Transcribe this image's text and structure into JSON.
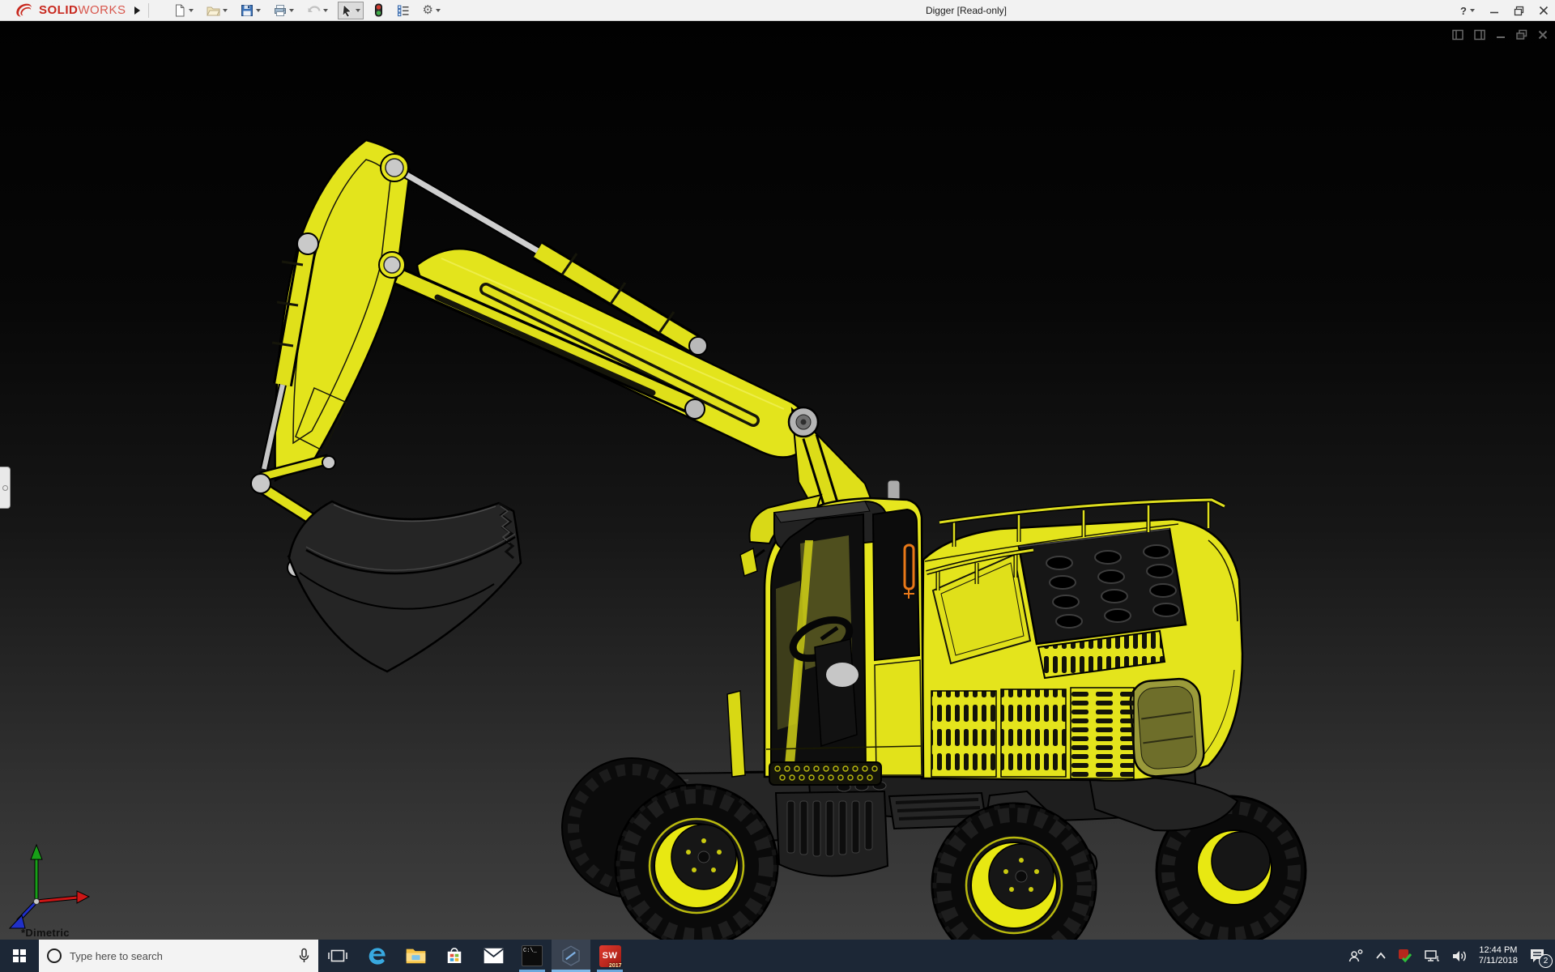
{
  "window": {
    "brand_bold": "SOLID",
    "brand_light": "WORKS",
    "title": "Digger [Read-only]",
    "help_label": "?"
  },
  "toolbar": {
    "icons": [
      "new-document",
      "open",
      "save",
      "print",
      "undo",
      "select-cursor",
      "rebuild-stoplight",
      "file-properties",
      "options-gear"
    ]
  },
  "viewport": {
    "view_label": "*Dimetric",
    "controls": [
      "pane-left-icon",
      "pane-right-icon",
      "minimize-icon",
      "restore-icon",
      "close-icon"
    ]
  },
  "taskbar": {
    "search_placeholder": "Type here to search",
    "cmd_label": "C:\\_",
    "sw_label": "SW",
    "sw_year": "2017",
    "apps": [
      "task-view",
      "edge",
      "file-explorer",
      "store",
      "mail",
      "command-prompt",
      "hexagon-app",
      "solidworks-2017"
    ],
    "tray": {
      "time": "12:44 PM",
      "date": "7/11/2018",
      "notification_count": "2"
    }
  },
  "colors": {
    "excavator_yellow": "#e4e41c",
    "titlebar_bg": "#f2f2f2",
    "taskbar_bg": "#1c2736",
    "taskbar_underline": "#6aa8dc",
    "brand_red": "#c8281e",
    "highlight_orange": "#e87818",
    "viewport_top": "#010101",
    "viewport_bottom": "#404040"
  }
}
